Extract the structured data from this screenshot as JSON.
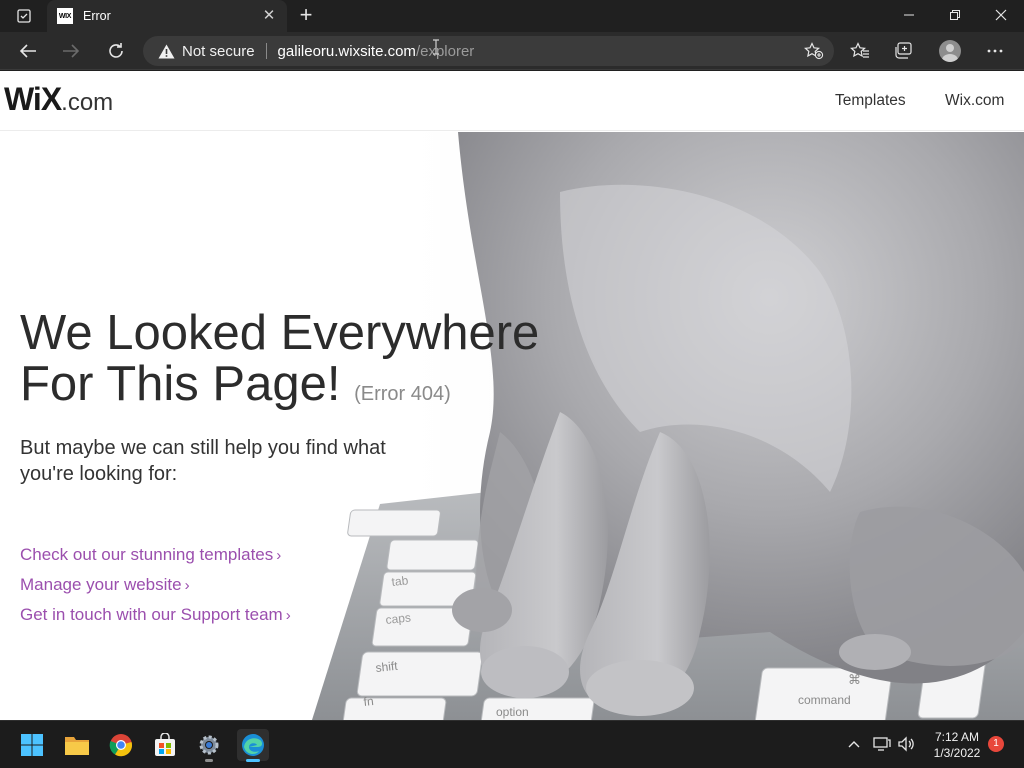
{
  "browser": {
    "tab": {
      "favicon_text": "WIX",
      "title": "Error"
    },
    "address": {
      "security_label": "Not secure",
      "host": "galileoru.wixsite.com",
      "path": "/explorer"
    }
  },
  "site": {
    "logo": {
      "wix": "WiX",
      "dotcom": ".com"
    },
    "nav": [
      {
        "label": "Templates"
      },
      {
        "label": "Wix.com"
      }
    ]
  },
  "error_page": {
    "headline_line1": "We Looked Everywhere",
    "headline_line2": "For This Page!",
    "error_code": "(Error 404)",
    "subtext": "But maybe we can still help you find what you're looking for:",
    "links": [
      {
        "label": "Check out our stunning templates"
      },
      {
        "label": "Manage your website"
      },
      {
        "label": "Get in touch with our Support team"
      }
    ],
    "link_color": "#9b4fae",
    "keyboard_keys": [
      "shift",
      "fn",
      "caps",
      "tab",
      "option",
      "command",
      "⌘"
    ]
  },
  "taskbar": {
    "apps": [
      {
        "name": "Start"
      },
      {
        "name": "File Explorer"
      },
      {
        "name": "Google Chrome"
      },
      {
        "name": "Microsoft Store"
      },
      {
        "name": "Settings"
      },
      {
        "name": "Microsoft Edge"
      }
    ],
    "clock": {
      "time": "7:12 AM",
      "date": "1/3/2022"
    },
    "notification_count": "1"
  }
}
